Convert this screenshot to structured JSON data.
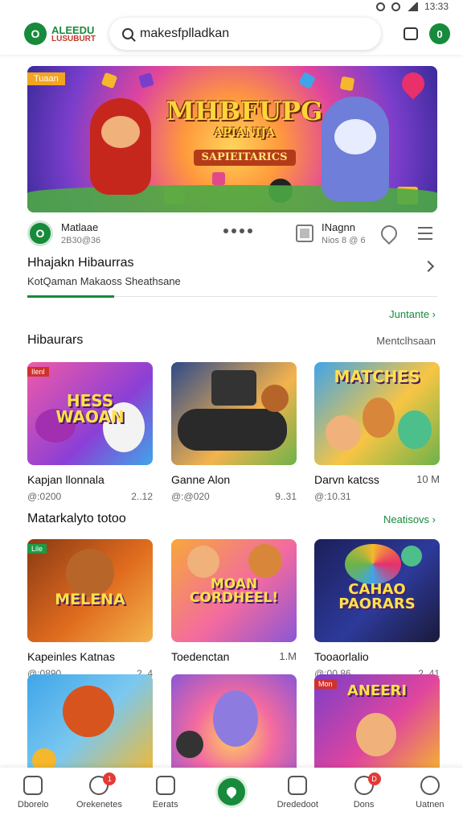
{
  "status": {
    "time": "13:33"
  },
  "header": {
    "logo_line1": "ALEEDU",
    "logo_line2": "LUSUBURT",
    "logo_badge": "O",
    "account_badge": "0",
    "search": {
      "value": "makesfplladkan",
      "placeholder": ""
    }
  },
  "banner": {
    "tag": "Tuaan",
    "title": "MHBFUPG",
    "subtitle": "APIANIJA",
    "subtitle2": "SAPIEITARICS"
  },
  "app_info": {
    "name": "Matlaae",
    "stat": "2B30@36",
    "right_name": "INagnn",
    "right_stat": "Nios 8 @ 6"
  },
  "featured": {
    "title": "Hhajakn Hibaurras",
    "subtitle": "KotQaman  Makaoss  Sheathsane",
    "more": "Juntante"
  },
  "section1": {
    "title": "Hibaurars",
    "right": "Mentclhsaan",
    "cards": [
      {
        "name": "Kapjan llonnala",
        "size": "",
        "meta_left": "@:0200",
        "meta_right": "2..12",
        "thumb_title": "HESS WAOAN",
        "tag": "Ilenl"
      },
      {
        "name": "Ganne Alon",
        "size": "",
        "meta_left": "@:@020",
        "meta_right": "9..31",
        "thumb_title": "",
        "tag": ""
      },
      {
        "name": "Darvn katcss",
        "size": "10 M",
        "meta_left": "@:10.31",
        "meta_right": "",
        "thumb_title": "MATCHES",
        "tag": ""
      }
    ]
  },
  "section2": {
    "title": "Matarkalyto totoo",
    "more": "Neatisovs",
    "cards": [
      {
        "name": "Kapeinles Katnas",
        "size": "",
        "meta_left": "@:0890",
        "meta_right": "2..4",
        "thumb_title": "MELENA",
        "tag": "Lile"
      },
      {
        "name": "Toedenctan",
        "size": "1.M",
        "meta_left": "",
        "meta_right": "",
        "thumb_title": "MOAN CORDHEEL!",
        "tag": ""
      },
      {
        "name": "Tooaorlalio",
        "size": "",
        "meta_left": "@:00.86",
        "meta_right": "2..41",
        "thumb_title": "CAHAO PAORARS",
        "tag": ""
      }
    ]
  },
  "section3": {
    "cards": [
      {
        "thumb_title": "",
        "tag": ""
      },
      {
        "thumb_title": "",
        "tag": ""
      },
      {
        "thumb_title": "ANEERI",
        "tag": "Mon"
      }
    ]
  },
  "nav": {
    "items": [
      {
        "label": "Dborelo",
        "badge": ""
      },
      {
        "label": "Orekenetes",
        "badge": "1"
      },
      {
        "label": "Eerats",
        "badge": ""
      },
      {
        "label": "",
        "badge": ""
      },
      {
        "label": "Drededoot",
        "badge": ""
      },
      {
        "label": "Dons",
        "badge": "D"
      },
      {
        "label": "Uatnen",
        "badge": ""
      }
    ]
  },
  "colors": {
    "accent": "#178a3c",
    "badge_red": "#e53935",
    "banner_gold": "#ffd43a"
  }
}
